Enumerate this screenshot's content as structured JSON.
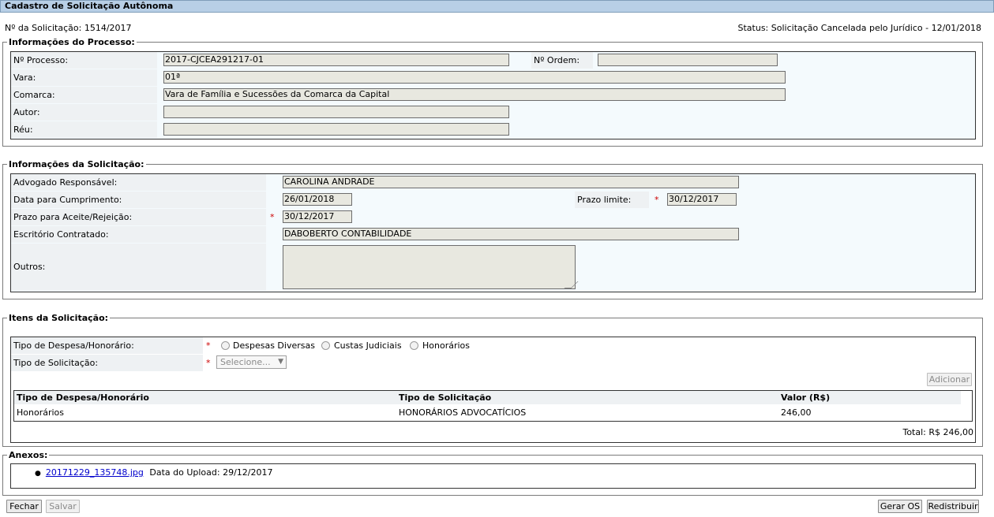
{
  "header": {
    "title": "Cadastro de Solicitação Autônoma"
  },
  "summary": {
    "numero_label": "Nº da Solicitação:",
    "numero_value": "1514/2017",
    "status_label": "Status:",
    "status_value": "Solicitação Cancelada pelo Jurídico - 12/01/2018"
  },
  "processo": {
    "legend": "Informações do Processo:",
    "processo_label": "Nº Processo:",
    "processo_value": "2017-CJCEA291217-01",
    "ordem_label": "Nº Ordem:",
    "ordem_value": "",
    "vara_label": "Vara:",
    "vara_value": "01ª",
    "comarca_label": "Comarca:",
    "comarca_value": "Vara de Família e Sucessões da Comarca da Capital",
    "autor_label": "Autor:",
    "autor_value": "",
    "reu_label": "Réu:",
    "reu_value": ""
  },
  "solicitacao": {
    "legend": "Informações da Solicitação:",
    "advogado_label": "Advogado Responsável:",
    "advogado_value": "CAROLINA ANDRADE",
    "data_label": "Data para Cumprimento:",
    "data_value": "26/01/2018",
    "prazo_limite_label": "Prazo limite:",
    "prazo_limite_value": "30/12/2017",
    "prazo_aceite_label": "Prazo para Aceite/Rejeição:",
    "prazo_aceite_value": "30/12/2017",
    "escritorio_label": "Escritório Contratado:",
    "escritorio_value": "DABOBERTO CONTABILIDADE",
    "outros_label": "Outros:",
    "outros_value": "",
    "required_mark": "*"
  },
  "itens": {
    "legend": "Itens da Solicitação:",
    "tipo_despesa_label": "Tipo de Despesa/Honorário:",
    "radio_options": [
      "Despesas Diversas",
      "Custas Judiciais",
      "Honorários"
    ],
    "tipo_solicitacao_label": "Tipo de Solicitação:",
    "tipo_solicitacao_placeholder": "Selecione...",
    "adicionar_label": "Adicionar",
    "table_headers": [
      "Tipo de Despesa/Honorário",
      "Tipo de Solicitação",
      "Valor (R$)"
    ],
    "rows": [
      [
        "Honorários",
        "HONORÁRIOS ADVOCATÍCIOS",
        "246,00"
      ]
    ],
    "total": "Total: R$ 246,00"
  },
  "anexos": {
    "legend": "Anexos:",
    "files": [
      {
        "name": "20171229_135748.jpg",
        "upload_label": "Data do Upload: 29/12/2017"
      }
    ]
  },
  "footer": {
    "fechar": "Fechar",
    "salvar": "Salvar",
    "gerar_os": "Gerar OS",
    "redistribuir": "Redistribuir"
  }
}
